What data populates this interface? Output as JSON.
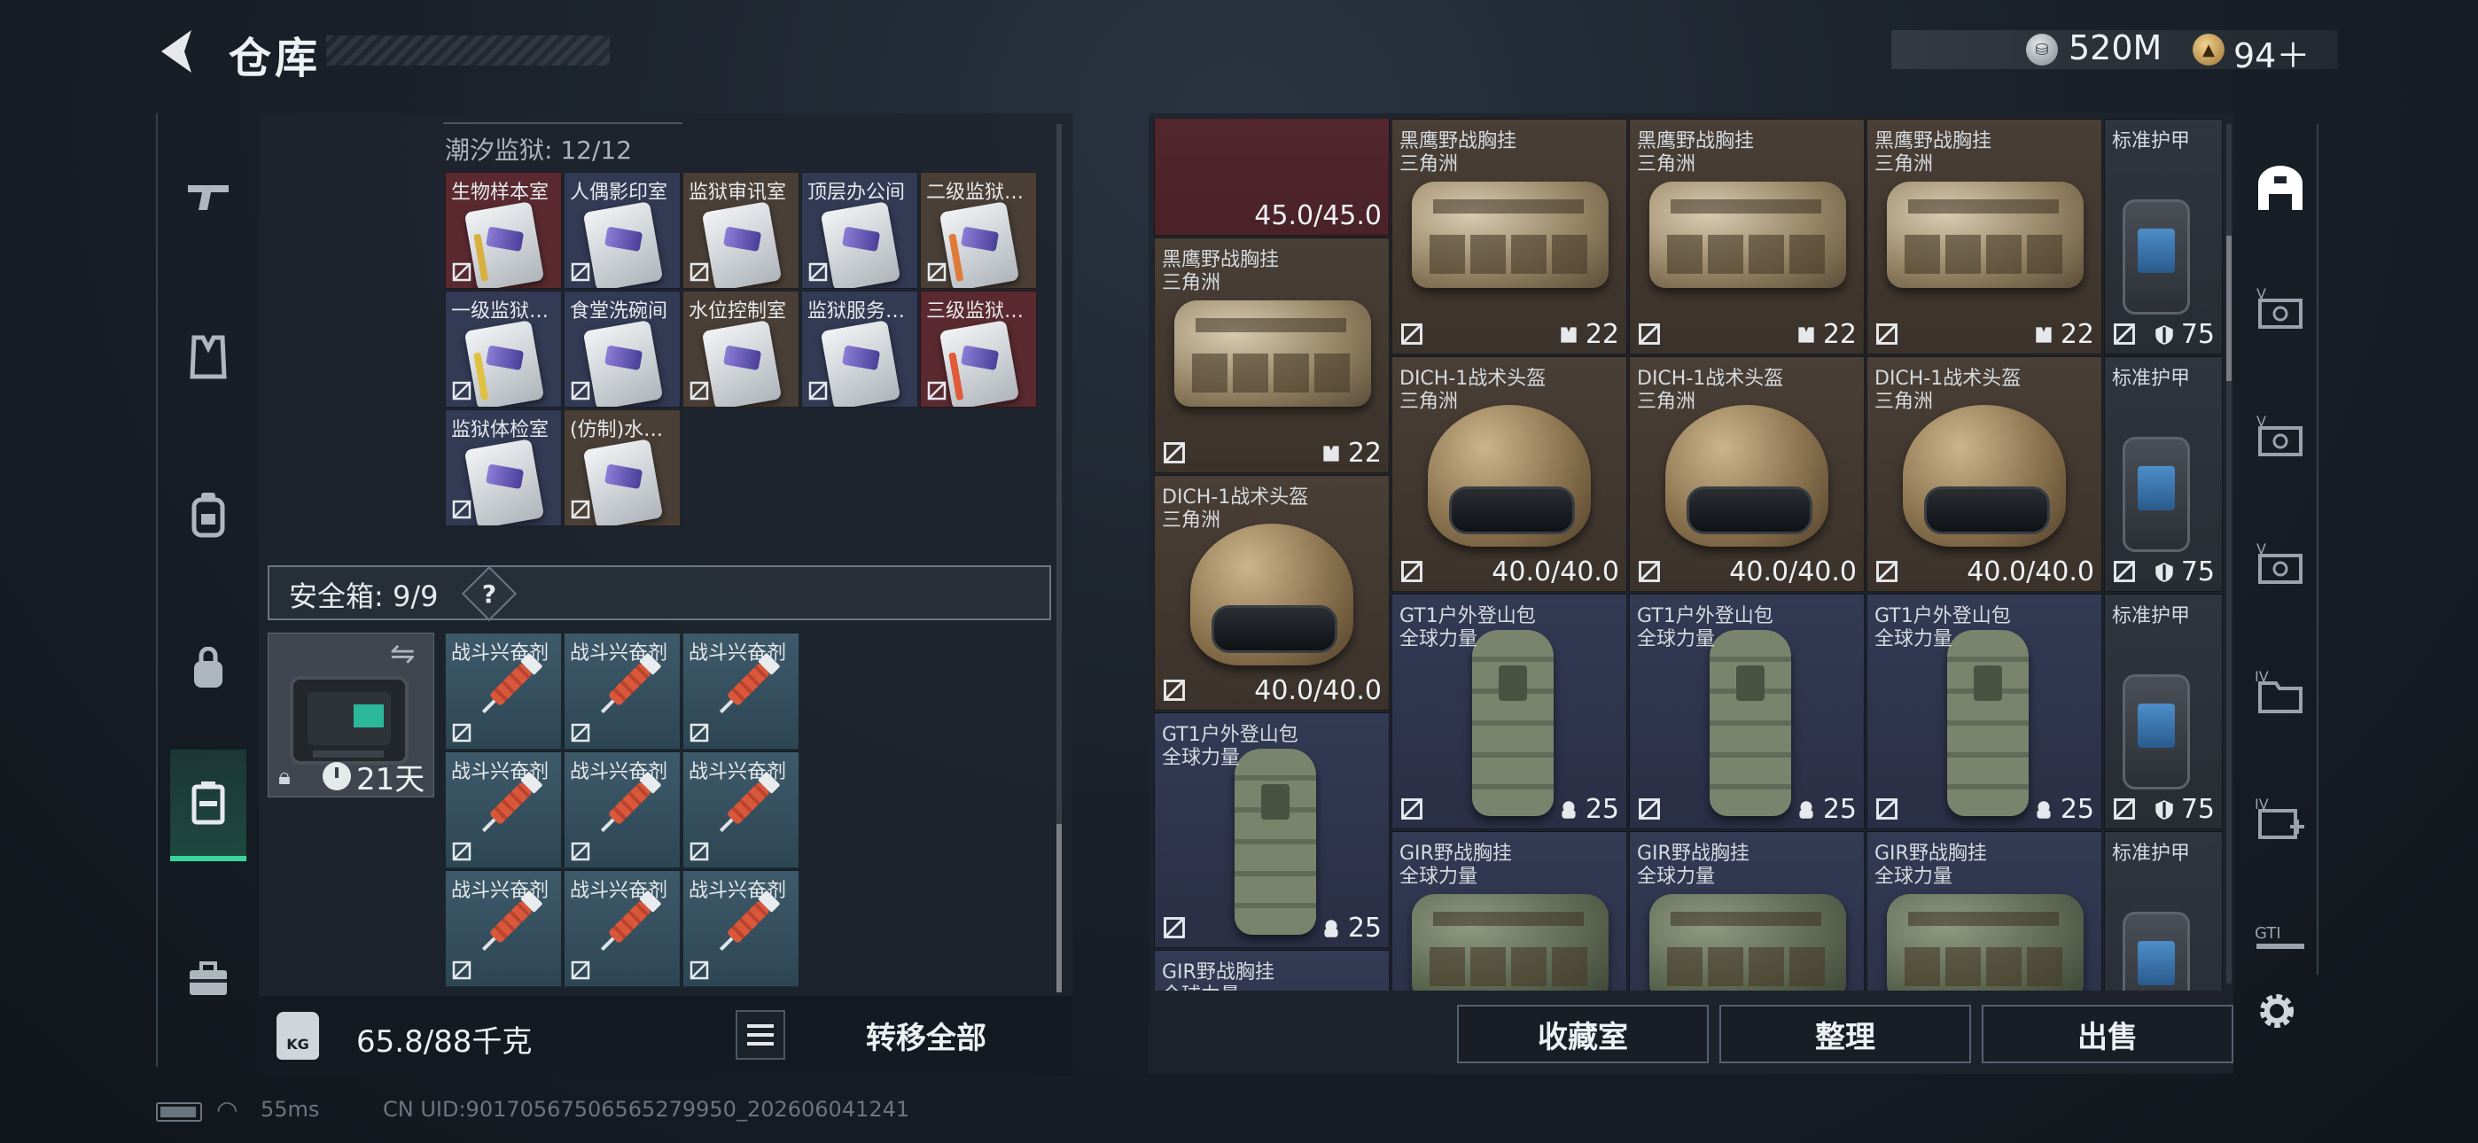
{
  "header": {
    "title": "仓库",
    "silver_amount": "520M",
    "gold_amount": "94＋",
    "tiny_text": ""
  },
  "colors": {
    "accent_green": "#38d69a",
    "key_red": "#5a2a30",
    "key_navy": "#333a54",
    "key_brown": "#4a3f36"
  },
  "left_nav": {
    "items": [
      "weapon-icon",
      "vest-icon",
      "backpack-icon",
      "bag-icon",
      "safe-case-icon",
      "toolbox-icon"
    ],
    "active_index": 4
  },
  "prison": {
    "label": "潮汐监狱: 12/12",
    "keys": [
      {
        "name": "生物样本室",
        "bg": "red",
        "stripe": "#d8b040"
      },
      {
        "name": "人偶影印室",
        "bg": "navy",
        "stripe": ""
      },
      {
        "name": "监狱审讯室",
        "bg": "brown",
        "stripe": ""
      },
      {
        "name": "顶层办公间",
        "bg": "navy",
        "stripe": ""
      },
      {
        "name": "二级监狱…",
        "bg": "brown",
        "stripe": "#e07a3a"
      },
      {
        "name": "一级监狱…",
        "bg": "navy",
        "stripe": "#e0c040"
      },
      {
        "name": "食堂洗碗间",
        "bg": "navy",
        "stripe": ""
      },
      {
        "name": "水位控制室",
        "bg": "brown",
        "stripe": ""
      },
      {
        "name": "监狱服务…",
        "bg": "navy",
        "stripe": ""
      },
      {
        "name": "三级监狱…",
        "bg": "red",
        "stripe": "#e05a3a"
      },
      {
        "name": "监狱体检室",
        "bg": "navy",
        "stripe": ""
      },
      {
        "name": "(仿制)水…",
        "bg": "brown",
        "stripe": ""
      }
    ]
  },
  "safe_box": {
    "label": "安全箱: 9/9",
    "help": "?",
    "days": "21天",
    "swap_icon": "swap-icon",
    "lock_icon": "lock-icon"
  },
  "stims": {
    "items": [
      "战斗兴奋剂",
      "战斗兴奋剂",
      "战斗兴奋剂",
      "战斗兴奋剂",
      "战斗兴奋剂",
      "战斗兴奋剂",
      "战斗兴奋剂",
      "战斗兴奋剂",
      "战斗兴奋剂"
    ]
  },
  "weight": {
    "icon_text": "KG",
    "value": "65.8/88千克",
    "transfer_label": "转移全部"
  },
  "storage": {
    "cells": [
      {
        "n1": "",
        "n2": "",
        "stat": "45.0/45.0",
        "kind": "mask",
        "bg": "red"
      },
      {
        "n1": "黑鹰野战胸挂",
        "n2": "三角洲",
        "stat": "22",
        "kind": "vest",
        "bg": "brown",
        "stat_icon": "capacity-icon"
      },
      {
        "n1": "黑鹰野战胸挂",
        "n2": "三角洲",
        "stat": "22",
        "kind": "vest",
        "bg": "brown",
        "stat_icon": "capacity-icon"
      },
      {
        "n1": "黑鹰野战胸挂",
        "n2": "三角洲",
        "stat": "22",
        "kind": "vest",
        "bg": "brown",
        "stat_icon": "capacity-icon"
      },
      {
        "n1": "标准护甲",
        "n2": "",
        "stat": "75",
        "kind": "armor",
        "bg": "gray",
        "stat_icon": "shield-icon"
      },
      {
        "n1": "黑鹰野战胸挂",
        "n2": "三角洲",
        "stat": "22",
        "kind": "vest",
        "bg": "brown",
        "stat_icon": "capacity-icon"
      },
      {
        "n1": "DICH-1战术头盔",
        "n2": "三角洲",
        "stat": "40.0/40.0",
        "kind": "helmet",
        "bg": "brown"
      },
      {
        "n1": "DICH-1战术头盔",
        "n2": "三角洲",
        "stat": "40.0/40.0",
        "kind": "helmet",
        "bg": "brown"
      },
      {
        "n1": "DICH-1战术头盔",
        "n2": "三角洲",
        "stat": "40.0/40.0",
        "kind": "helmet",
        "bg": "brown"
      },
      {
        "n1": "标准护甲",
        "n2": "",
        "stat": "75",
        "kind": "armor",
        "bg": "gray",
        "stat_icon": "shield-icon"
      },
      {
        "n1": "DICH-1战术头盔",
        "n2": "三角洲",
        "stat": "40.0/40.0",
        "kind": "helmet",
        "bg": "brown"
      },
      {
        "n1": "GT1户外登山包",
        "n2": "全球力量",
        "stat": "25",
        "kind": "pack",
        "bg": "navy",
        "stat_icon": "pack-capacity-icon"
      },
      {
        "n1": "GT1户外登山包",
        "n2": "全球力量",
        "stat": "25",
        "kind": "pack",
        "bg": "navy",
        "stat_icon": "pack-capacity-icon"
      },
      {
        "n1": "GT1户外登山包",
        "n2": "全球力量",
        "stat": "25",
        "kind": "pack",
        "bg": "navy",
        "stat_icon": "pack-capacity-icon"
      },
      {
        "n1": "标准护甲",
        "n2": "",
        "stat": "75",
        "kind": "armor",
        "bg": "gray",
        "stat_icon": "shield-icon"
      },
      {
        "n1": "GT1户外登山包",
        "n2": "全球力量",
        "stat": "25",
        "kind": "pack",
        "bg": "navy",
        "stat_icon": "pack-capacity-icon"
      },
      {
        "n1": "GIR野战胸挂",
        "n2": "全球力量",
        "stat": "",
        "kind": "gvest",
        "bg": "navy"
      },
      {
        "n1": "GIR野战胸挂",
        "n2": "全球力量",
        "stat": "",
        "kind": "gvest",
        "bg": "navy"
      },
      {
        "n1": "GIR野战胸挂",
        "n2": "全球力量",
        "stat": "",
        "kind": "gvest",
        "bg": "navy"
      },
      {
        "n1": "标准护甲",
        "n2": "",
        "stat": "",
        "kind": "armor",
        "bg": "gray"
      },
      {
        "n1": "GIR野战胸挂",
        "n2": "全球力量",
        "stat": "",
        "kind": "gvest",
        "bg": "navy"
      }
    ]
  },
  "bottom_buttons": {
    "collection": "收藏室",
    "sort": "整理",
    "sell": "出售"
  },
  "right_nav": {
    "items": [
      "storage-home-icon",
      "tab-v1-icon",
      "tab-v2-icon",
      "tab-v3-icon",
      "tab-iv1-icon",
      "tab-iv2-icon",
      "tab-gt1-icon"
    ],
    "active_index": 0
  },
  "status": {
    "ping": "55ms",
    "uid": "CN UID:90170567506565279950_202606041241"
  }
}
